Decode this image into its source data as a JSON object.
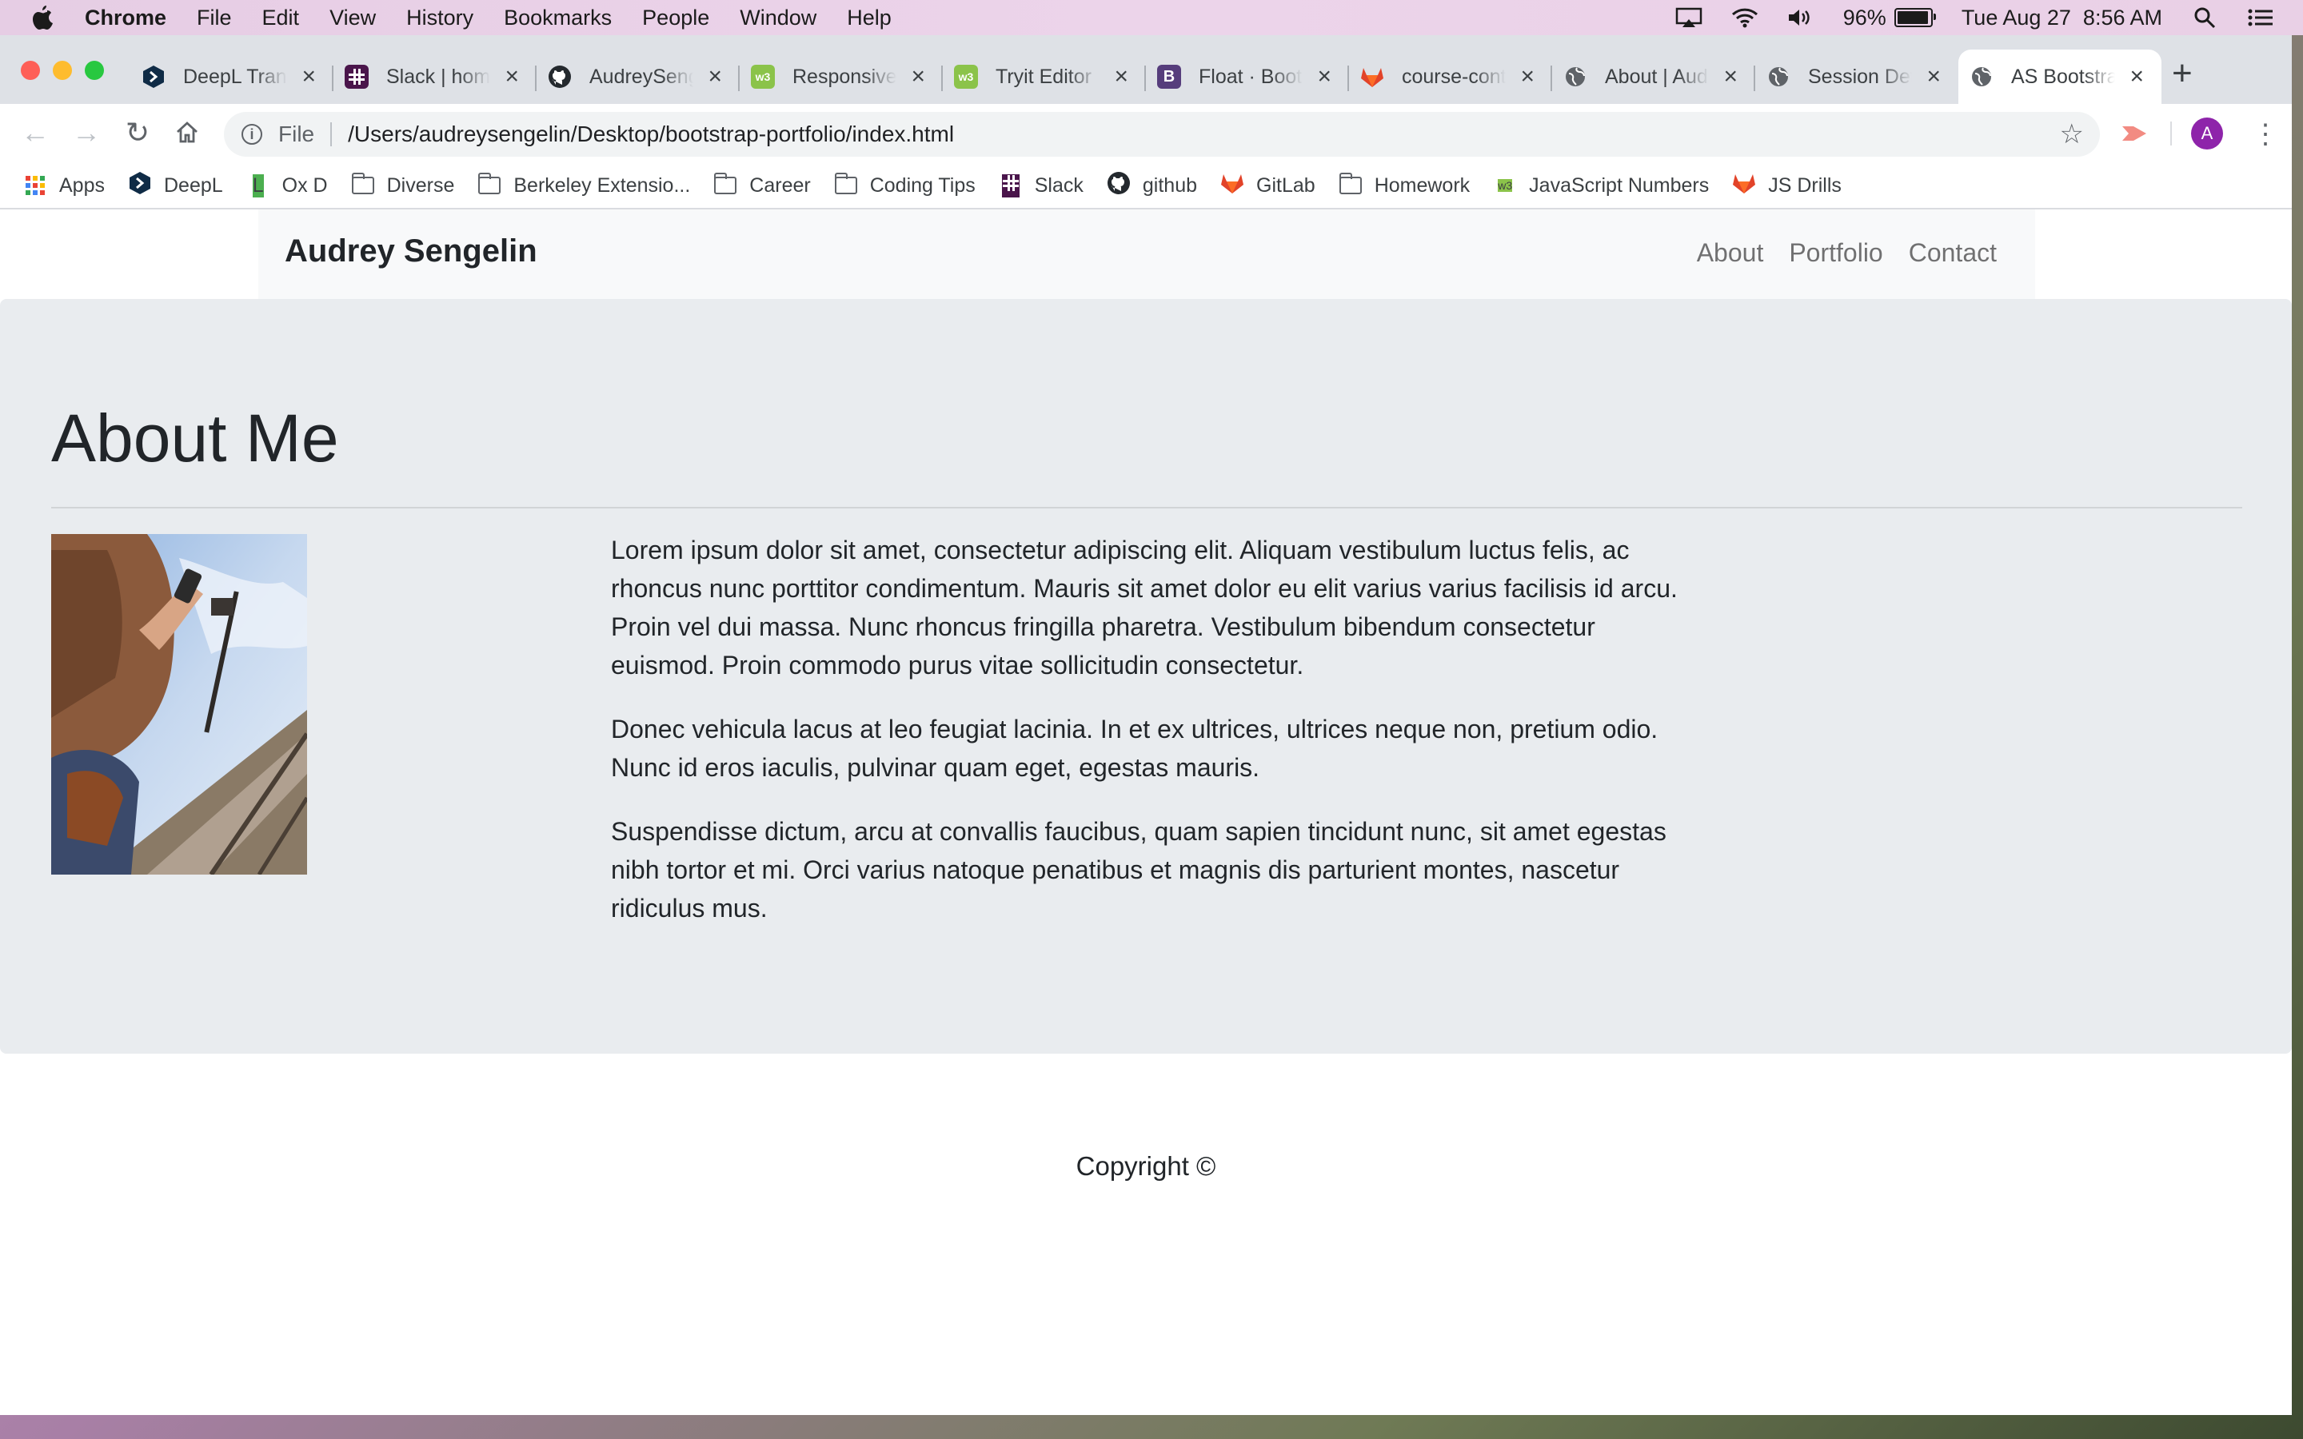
{
  "menubar": {
    "app": "Chrome",
    "items": [
      "File",
      "Edit",
      "View",
      "History",
      "Bookmarks",
      "People",
      "Window",
      "Help"
    ],
    "battery_percent": "96%",
    "battery_level": 0.96,
    "datetime": "Tue Aug 27  8:56 AM"
  },
  "tabs": [
    {
      "title": "DeepL Translator",
      "icon": "deepl-icon",
      "color": "#0f2b46"
    },
    {
      "title": "Slack | home",
      "icon": "slack-icon",
      "color": "#4a154b"
    },
    {
      "title": "AudreySengelin",
      "icon": "github-icon",
      "color": "#24292e"
    },
    {
      "title": "Responsive",
      "icon": "w3schools-icon",
      "color": "#8bc34a"
    },
    {
      "title": "Tryit Editor",
      "icon": "w3schools-icon",
      "color": "#8bc34a"
    },
    {
      "title": "Float · Bootstrap",
      "icon": "bootstrap-icon",
      "color": "#563d7c"
    },
    {
      "title": "course-content",
      "icon": "gitlab-icon",
      "color": "#e24329"
    },
    {
      "title": "About | Audrey",
      "icon": "globe-icon",
      "color": "#5f6368"
    },
    {
      "title": "Session Details",
      "icon": "globe-icon",
      "color": "#5f6368"
    },
    {
      "title": "AS Bootstrap",
      "icon": "globe-icon",
      "color": "#5f6368",
      "active": true
    }
  ],
  "omnibox": {
    "scheme": "File",
    "url": "/Users/audreysengelin/Desktop/bootstrap-portfolio/index.html"
  },
  "avatar_letter": "A",
  "bookmarks": [
    {
      "label": "Apps",
      "icon": "apps-grid-icon"
    },
    {
      "label": "DeepL",
      "icon": "deepl-icon"
    },
    {
      "label": "Ox D",
      "icon": "letter-l-icon"
    },
    {
      "label": "Diverse",
      "icon": "folder-icon"
    },
    {
      "label": "Berkeley Extensio...",
      "icon": "folder-icon"
    },
    {
      "label": "Career",
      "icon": "folder-icon"
    },
    {
      "label": "Coding Tips",
      "icon": "folder-icon"
    },
    {
      "label": "Slack",
      "icon": "slack-icon"
    },
    {
      "label": "github",
      "icon": "github-icon"
    },
    {
      "label": "GitLab",
      "icon": "gitlab-icon"
    },
    {
      "label": "Homework",
      "icon": "folder-icon"
    },
    {
      "label": "JavaScript Numbers",
      "icon": "w3schools-icon"
    },
    {
      "label": "JS Drills",
      "icon": "gitlab-icon"
    }
  ],
  "site": {
    "brand": "Audrey Sengelin",
    "nav": [
      "About",
      "Portfolio",
      "Contact"
    ],
    "heading": "About Me",
    "paragraphs": [
      "Lorem ipsum dolor sit amet, consectetur adipiscing elit. Aliquam vestibulum luctus felis, ac rhoncus nunc porttitor condimentum. Mauris sit amet dolor eu elit varius varius facilisis id arcu. Proin vel dui massa. Nunc rhoncus fringilla pharetra. Vestibulum bibendum consectetur euismod. Proin commodo purus vitae sollicitudin consectetur.",
      "Donec vehicula lacus at leo feugiat lacinia. In et ex ultrices, ultrices neque non, pretium odio. Nunc id eros iaculis, pulvinar quam eget, egestas mauris.",
      "Suspendisse dictum, arcu at convallis faucibus, quam sapien tincidunt nunc, sit amet egestas nibh tortor et mi. Orci varius natoque penatibus et magnis dis parturient montes, nascetur ridiculus mus."
    ],
    "footer": "Copyright ©"
  }
}
